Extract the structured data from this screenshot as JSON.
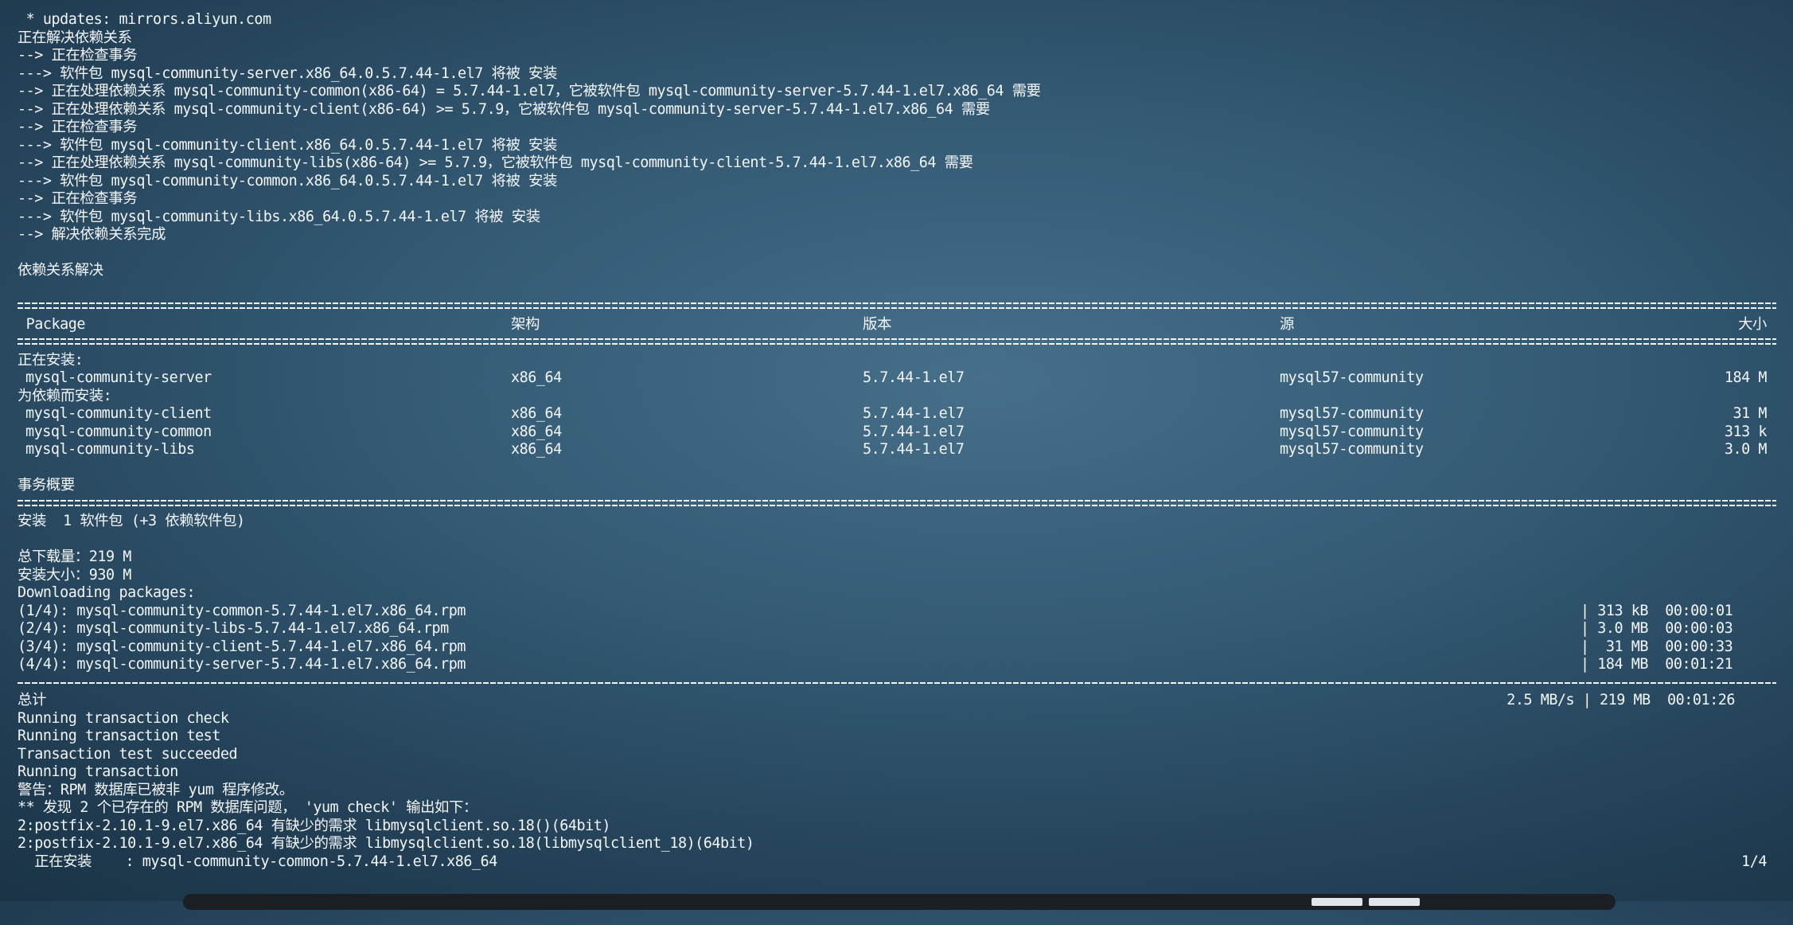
{
  "terminal": {
    "pre_lines": [
      " * updates: mirrors.aliyun.com",
      "正在解决依赖关系",
      "--> 正在检查事务",
      "---> 软件包 mysql-community-server.x86_64.0.5.7.44-1.el7 将被 安装",
      "--> 正在处理依赖关系 mysql-community-common(x86-64) = 5.7.44-1.el7，它被软件包 mysql-community-server-5.7.44-1.el7.x86_64 需要",
      "--> 正在处理依赖关系 mysql-community-client(x86-64) >= 5.7.9，它被软件包 mysql-community-server-5.7.44-1.el7.x86_64 需要",
      "--> 正在检查事务",
      "---> 软件包 mysql-community-client.x86_64.0.5.7.44-1.el7 将被 安装",
      "--> 正在处理依赖关系 mysql-community-libs(x86-64) >= 5.7.9，它被软件包 mysql-community-client-5.7.44-1.el7.x86_64 需要",
      "---> 软件包 mysql-community-common.x86_64.0.5.7.44-1.el7 将被 安装",
      "--> 正在检查事务",
      "---> 软件包 mysql-community-libs.x86_64.0.5.7.44-1.el7 将被 安装",
      "--> 解决依赖关系完成",
      "",
      "依赖关系解决",
      ""
    ],
    "table": {
      "headers": {
        "package": " Package",
        "arch": "架构",
        "version": "版本",
        "repo": "源",
        "size": "大小"
      },
      "installing_label": "正在安装:",
      "dependency_label": "为依赖而安装:",
      "installing": [
        {
          "name": "mysql-community-server",
          "arch": "x86_64",
          "version": "5.7.44-1.el7",
          "repo": "mysql57-community",
          "size": "184 M"
        }
      ],
      "dependencies": [
        {
          "name": "mysql-community-client",
          "arch": "x86_64",
          "version": "5.7.44-1.el7",
          "repo": "mysql57-community",
          "size": "31 M"
        },
        {
          "name": "mysql-community-common",
          "arch": "x86_64",
          "version": "5.7.44-1.el7",
          "repo": "mysql57-community",
          "size": "313 k"
        },
        {
          "name": "mysql-community-libs",
          "arch": "x86_64",
          "version": "5.7.44-1.el7",
          "repo": "mysql57-community",
          "size": "3.0 M"
        }
      ]
    },
    "summary": {
      "title": "事务概要",
      "install_line": "安装  1 软件包 (+3 依赖软件包)",
      "download_size": "总下载量：219 M",
      "install_size": "安装大小：930 M",
      "downloading_label": "Downloading packages:"
    },
    "downloads": [
      {
        "file": "(1/4): mysql-community-common-5.7.44-1.el7.x86_64.rpm",
        "progress": "| 313 kB  00:00:01"
      },
      {
        "file": "(2/4): mysql-community-libs-5.7.44-1.el7.x86_64.rpm",
        "progress": "| 3.0 MB  00:00:03"
      },
      {
        "file": "(3/4): mysql-community-client-5.7.44-1.el7.x86_64.rpm",
        "progress": "|  31 MB  00:00:33"
      },
      {
        "file": "(4/4): mysql-community-server-5.7.44-1.el7.x86_64.rpm",
        "progress": "| 184 MB  00:01:21"
      }
    ],
    "total": {
      "label": "总计",
      "value": "2.5 MB/s | 219 MB  00:01:26"
    },
    "post_lines": [
      "Running transaction check",
      "Running transaction test",
      "Transaction test succeeded",
      "Running transaction",
      "警告：RPM 数据库已被非 yum 程序修改。",
      "** 发现 2 个已存在的 RPM 数据库问题， 'yum check' 输出如下：",
      "2:postfix-2.10.1-9.el7.x86_64 有缺少的需求 libmysqlclient.so.18()(64bit)",
      "2:postfix-2.10.1-9.el7.x86_64 有缺少的需求 libmysqlclient.so.18(libmysqlclient_18)(64bit)"
    ],
    "current": {
      "text": "  正在安装    : mysql-community-common-5.7.44-1.el7.x86_64",
      "count": "1/4"
    }
  }
}
